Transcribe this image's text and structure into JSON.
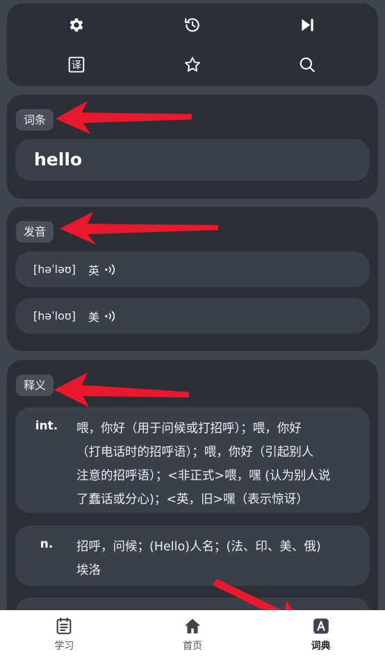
{
  "toolbar": {
    "icons": [
      "gear-icon",
      "history-icon",
      "skip-next-icon",
      "translate-icon",
      "star-icon",
      "search-icon"
    ],
    "translate_glyph": "译"
  },
  "entry": {
    "chip": "词条",
    "word": "hello"
  },
  "pronunciation": {
    "chip": "发音",
    "items": [
      {
        "ipa": "[həˈləʊ]",
        "locale": "英",
        "icon": "speaker-icon"
      },
      {
        "ipa": "[həˈloʊ]",
        "locale": "美",
        "icon": "speaker-icon"
      }
    ]
  },
  "definition": {
    "chip": "释义",
    "items": [
      {
        "pos": "int.",
        "text": "喂，你好（用于问候或打招呼）；喂，你好\n（打电话时的招呼语）；喂，你好（引起别人\n注意的招呼语）；<非正式>喂，嘿 (认为别人说\n了蠢话或分心)；<英，旧>嘿（表示惊讶）"
      },
      {
        "pos": "n.",
        "text": "招呼，问候；(Hello)人名；(法、印、美、俄)\n埃洛"
      }
    ]
  },
  "bottom_nav": {
    "items": [
      {
        "label": "学习",
        "icon": "study-icon"
      },
      {
        "label": "首页",
        "icon": "home-icon"
      },
      {
        "label": "词典",
        "icon": "dictionary-icon",
        "active": true
      }
    ]
  },
  "colors": {
    "background": "#3f444f",
    "card": "#2c2f36",
    "pill": "#3b3f48",
    "chip": "#4a4e58",
    "annotation_arrow": "#e8192c"
  }
}
